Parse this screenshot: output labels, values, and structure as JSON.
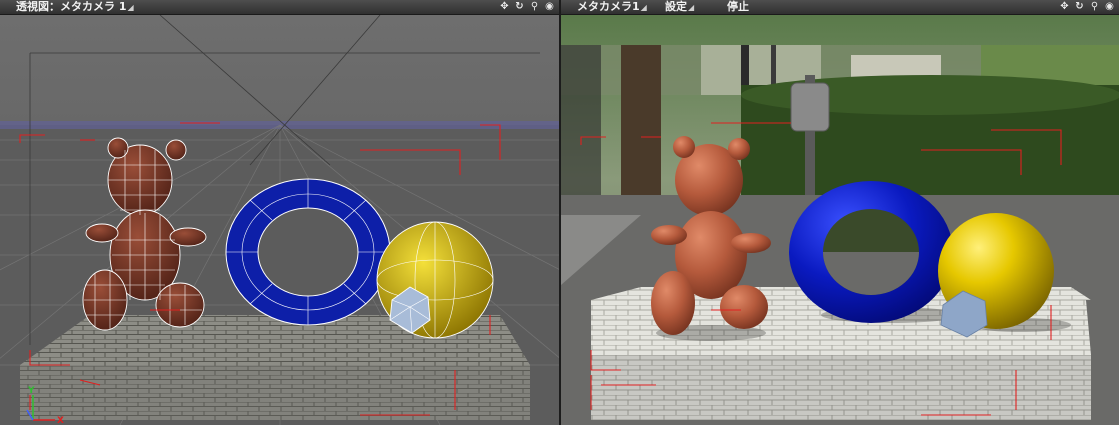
{
  "left_view": {
    "title": "透視図：メタカメラ 1",
    "icons": [
      "move-view-icon",
      "rotate-view-icon",
      "zoom-view-icon",
      "view-options-icon"
    ],
    "axes": {
      "y": "Y",
      "x": "X"
    }
  },
  "right_view": {
    "menu": [
      {
        "name": "camera-menu",
        "label": "メタカメラ1"
      },
      {
        "name": "settings-menu",
        "label": "設定"
      },
      {
        "name": "stop-button",
        "label": "停止"
      }
    ],
    "icons": [
      "move-view-icon",
      "rotate-view-icon",
      "zoom-view-icon",
      "view-options-icon"
    ]
  },
  "colors": {
    "grid_floor": "#5a5a5a",
    "wireframe": "#ffffff",
    "bear": "#7a3a2a",
    "bear_render": "#b55a3c",
    "torus": "#0a1aa8",
    "sphere": "#d8c000",
    "gem": "#8ea6c8",
    "bounding_box": "#e02020",
    "brick": "#9a9a92"
  }
}
